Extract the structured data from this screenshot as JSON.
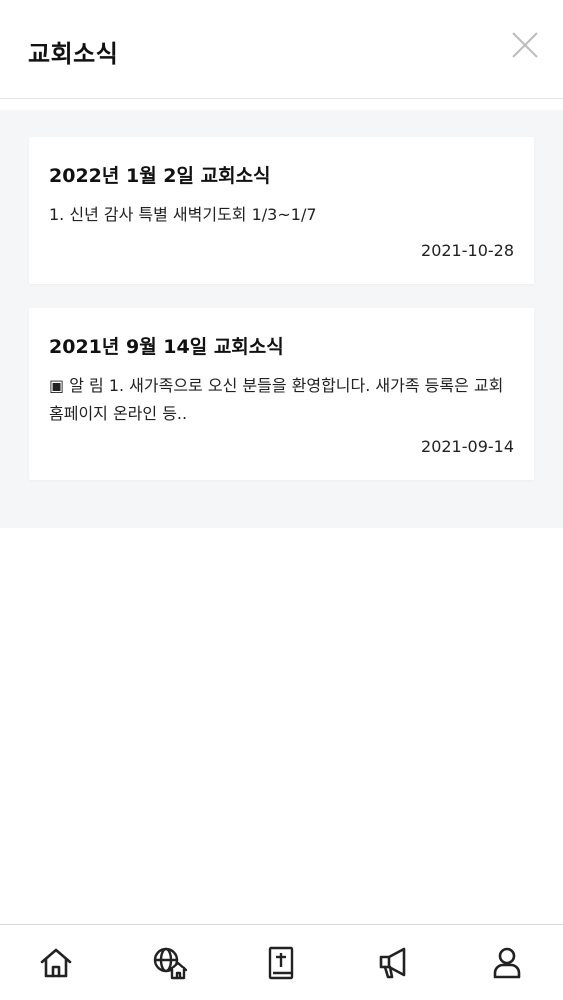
{
  "header": {
    "title": "교회소식",
    "close_icon": "close-icon"
  },
  "posts": [
    {
      "title": "2022년 1월 2일 교회소식",
      "summary": "1. 신년 감사 특별 새벽기도회 1/3~1/7",
      "date": "2021-10-28"
    },
    {
      "title": "2021년 9월 14일 교회소식",
      "summary": "▣ 알 림 1. 새가족으로 오신 분들을 환영합니다. 새가족 등록은 교회 홈페이지 온라인 등..",
      "date": "2021-09-14"
    }
  ],
  "bottom_nav": {
    "items": [
      {
        "icon": "home-icon"
      },
      {
        "icon": "globe-home-icon"
      },
      {
        "icon": "bible-icon"
      },
      {
        "icon": "megaphone-icon"
      },
      {
        "icon": "user-icon"
      }
    ]
  },
  "colors": {
    "background": "#ffffff",
    "content_background": "#f4f6f7",
    "text": "#111111",
    "divider": "#e6e6e6"
  }
}
